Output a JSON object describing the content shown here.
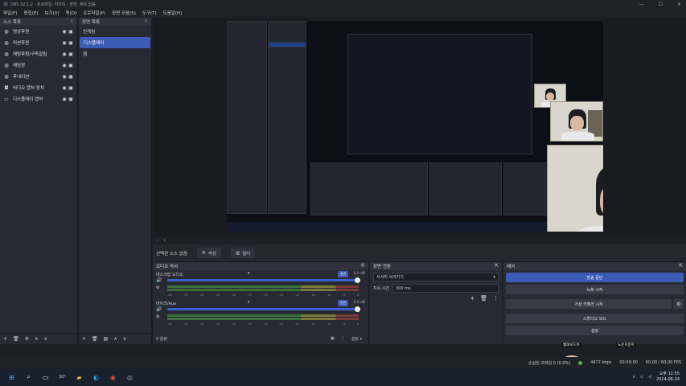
{
  "window": {
    "title": "OBS 32.1.2 - 프로파일: 지지직 - 장면: 제목 없음",
    "controls": [
      "—",
      "☐",
      "✕"
    ]
  },
  "menu": [
    "파일(F)",
    "편집(E)",
    "보기(V)",
    "독(D)",
    "프로파일(P)",
    "장면 모음(S)",
    "도구(T)",
    "도움말(H)"
  ],
  "sources": {
    "title": "소스 목록",
    "items": [
      {
        "label": "영상후원",
        "icon": "globe-icon"
      },
      {
        "label": "미션후원",
        "icon": "globe-icon"
      },
      {
        "label": "채팅후원/구독알림",
        "icon": "globe-icon"
      },
      {
        "label": "채팅창",
        "icon": "globe-icon"
      },
      {
        "label": "후네이션",
        "icon": "globe-icon"
      },
      {
        "label": "비디오 캡처 장치",
        "icon": "camera-icon"
      },
      {
        "label": "디스플레이 캡처",
        "icon": "monitor-icon"
      }
    ]
  },
  "scenes": {
    "title": "장면 목록",
    "items": [
      {
        "label": "인게임",
        "active": false
      },
      {
        "label": "디스플레이",
        "active": true
      },
      {
        "label": "캠",
        "active": false
      }
    ]
  },
  "context": {
    "no_source": "선택된 소스 없음",
    "properties": "속성",
    "filters": "필터"
  },
  "mixer": {
    "title": "오디오 믹서",
    "tracks": [
      {
        "name": "데스크탑 오디오",
        "db": "0.0 dB",
        "tag": "한번",
        "volume": 1.0
      },
      {
        "name": "마이크/Aux",
        "db": "0.0 dB",
        "tag": "한번",
        "volume": 1.0
      }
    ],
    "ticks": [
      "-60",
      "-55",
      "-50",
      "-45",
      "-40",
      "-35",
      "-30",
      "-25",
      "-20",
      "-15",
      "-10",
      "-5",
      "0"
    ],
    "footer_left": "0 음량",
    "footer_settings": "설정"
  },
  "transition": {
    "title": "장면 전환",
    "type": "서서히 사라지기",
    "duration_label": "지속 시간",
    "duration": "300 ms"
  },
  "controls": {
    "title": "제어",
    "stop_stream": "방송 중단",
    "start_record": "녹화 시작",
    "virtual_cam": "가상 카메라 시작",
    "studio_mode": "스튜디오 모드",
    "settings": "설정"
  },
  "stickers": {
    "left": "쌤혀보드카",
    "right": "노운치운지"
  },
  "status": {
    "dropped": "손실된 프레임 0 (0.0%)",
    "bitrate": "4477 kbps",
    "live_time": "00:00:00",
    "fps": "60.00 / 60.00 FPS"
  },
  "taskbar": {
    "weather": "30°",
    "time": "오후 11:55",
    "date": "2024-06-24"
  },
  "colors": {
    "accent": "#3b5bb5",
    "panel": "#272a33",
    "background": "#1d1f26"
  }
}
